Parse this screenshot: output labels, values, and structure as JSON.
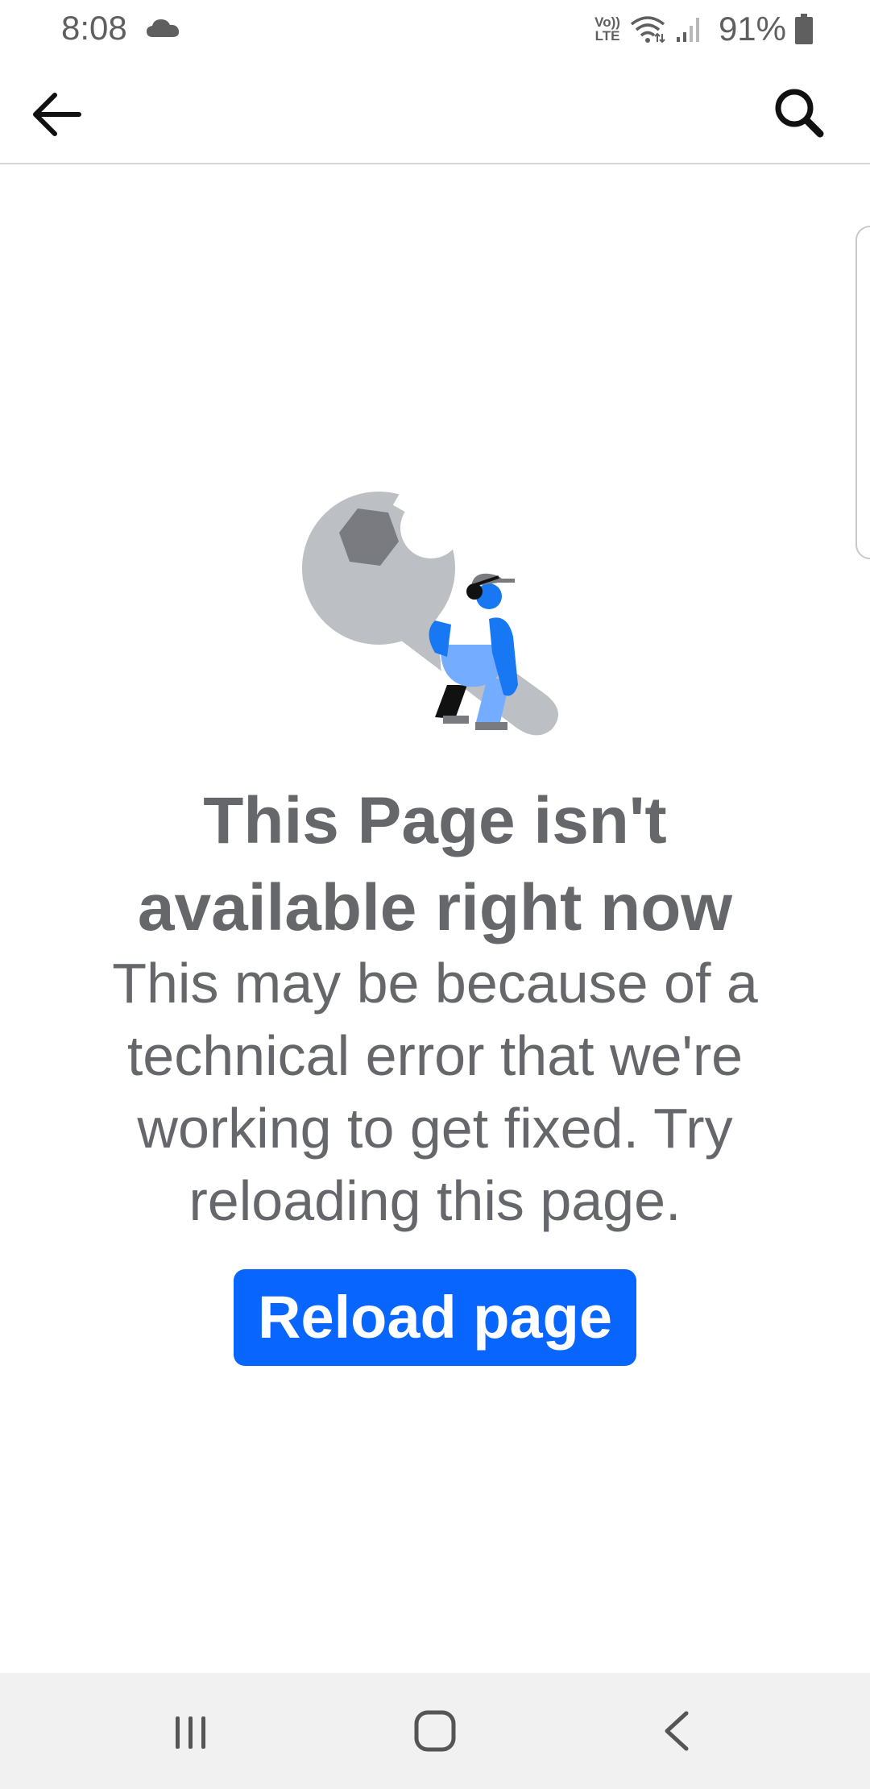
{
  "status_bar": {
    "time": "8:08",
    "cloud_icon": "cloud-icon",
    "volte_top": "Vo))",
    "volte_bottom": "LTE",
    "wifi_icon": "wifi-icon",
    "signal_icon": "signal-icon",
    "battery": "91%",
    "battery_icon": "battery-icon"
  },
  "top_bar": {
    "back_icon": "arrow-left-icon",
    "search_icon": "search-icon"
  },
  "error": {
    "illustration": "maintenance-wrench-illustration",
    "title_line1": "This Page isn't",
    "title_line2": "available right now",
    "body_line1": "This may be because of a",
    "body_line2": "technical error that we're",
    "body_line3": "working to get fixed. Try",
    "body_line4": "reloading this page.",
    "button_label": "Reload page"
  },
  "nav_bar": {
    "recents_icon": "recents-icon",
    "home_icon": "home-icon",
    "back_icon": "nav-back-icon"
  },
  "colors": {
    "accent": "#0866ff",
    "text_secondary": "#65676b",
    "nav_background": "#f1f1f1",
    "illustration_gray": "#bcc0c4",
    "illustration_blue": "#1877f2",
    "illustration_light_blue": "#74adff"
  }
}
